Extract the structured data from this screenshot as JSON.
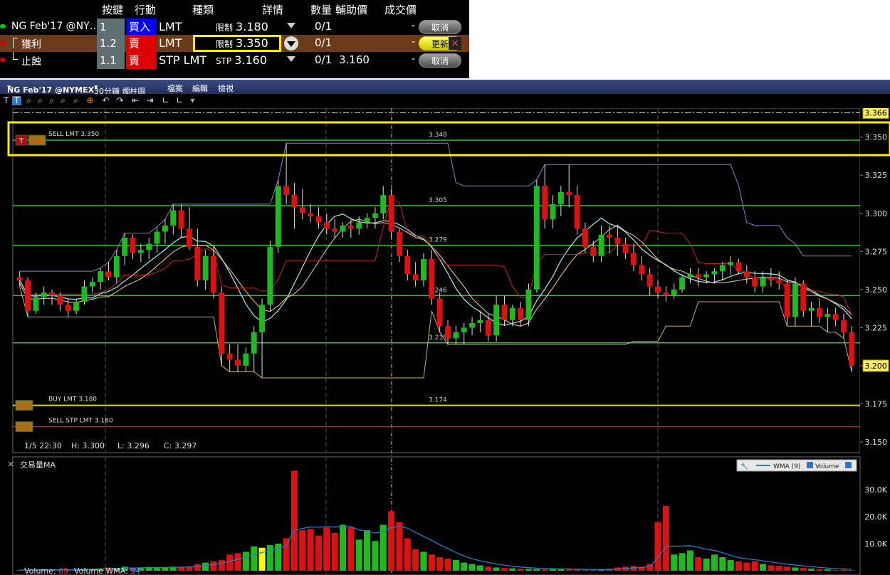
{
  "order_panel": {
    "headers": {
      "key": "按鍵",
      "action": "行動",
      "type": "種類",
      "detail": "詳情",
      "qty": "數量",
      "aux": "輔助價",
      "fill": "成交價"
    },
    "rows": [
      {
        "symbol": "NG Feb'17 @NY…",
        "key": "1",
        "action": "買入",
        "action_color": "#0000ff",
        "type": "LMT",
        "detail_prefix": "限制",
        "detail_price": "3.180",
        "qty": "0/1",
        "aux": "",
        "fill": "-",
        "button": "取消",
        "bullet_color": "#00cc00",
        "row_bg": "#000000"
      },
      {
        "symbol": "獲利",
        "key": "1.2",
        "action": "賣",
        "action_color": "#dd0000",
        "type": "LMT",
        "detail_prefix": "限制",
        "detail_price": "3.350",
        "qty": "0/1",
        "aux": "",
        "fill": "-",
        "button": "更新",
        "close_icon": "×",
        "bullet_color": "#cc0000",
        "row_bg": "#6b3a1a"
      },
      {
        "symbol": "止蝕",
        "key": "1.1",
        "action": "賣",
        "action_color": "#dd0000",
        "type": "STP LMT",
        "detail_prefix": "STP",
        "detail_price": "3.160",
        "qty": "0/1",
        "aux": "3.160",
        "fill": "-",
        "button": "取消",
        "bullet_color": "#cc0000",
        "row_bg": "#000000"
      }
    ]
  },
  "chart": {
    "title_bar": {
      "symbol": "NG Feb'17 @NYMEX",
      "interval": "30分鐘 燭柱圖",
      "menu_file": "檔案",
      "menu_edit": "編輯",
      "menu_view": "檢視"
    },
    "toolbar_icons": [
      "T",
      "T",
      "zoom-in-icon",
      "zoom-out-icon",
      "zoom-out-icon",
      "crosshair-icon",
      "undo-icon",
      "redo-icon",
      "fit-icon",
      "fit-icon",
      "drawing-icon",
      "drawing-icon",
      "chevron-down-icon"
    ],
    "readout": {
      "date": "1/5 22:30",
      "high": "H: 3.300",
      "low": "L: 3.296",
      "close": "C: 3.297"
    },
    "price_axis_ticks": [
      "3.350",
      "3.325",
      "3.300",
      "3.275",
      "3.250",
      "3.225",
      "3.200",
      "3.175",
      "3.150"
    ],
    "price_badges": {
      "top": "3.366",
      "last": "3.200"
    },
    "order_lines": [
      {
        "label": "SELL LMT 3.350",
        "price": 3.348,
        "price_label": "3.348",
        "color": "#22cc22",
        "tags": [
          "T",
          "CXL"
        ]
      },
      {
        "label": "BUY LMT 3.180",
        "price": 3.174,
        "price_label": "3.174",
        "color": "#dddd00",
        "tags": [
          "CXL"
        ]
      },
      {
        "label": "SELL STP LMT 3.160",
        "price": 3.16,
        "price_label": "",
        "color": "#cc2222",
        "tags": [
          "CXL"
        ]
      }
    ],
    "level_lines": [
      {
        "price": 3.305,
        "label": "3.305"
      },
      {
        "price": 3.279,
        "label": "3.279"
      },
      {
        "price": 3.246,
        "label": "3.246"
      },
      {
        "price": 3.215,
        "label": "3.215"
      }
    ],
    "volume_panel": {
      "title": "交易量MA",
      "legend_wma": "WMA (9)",
      "legend_volume": "Volume",
      "axis_ticks": [
        "30.0K",
        "20.0K",
        "10.0K"
      ],
      "volume_label": "Volume:",
      "volume_value": "69",
      "wma_label": "Volume WMA:",
      "wma_value": "94"
    }
  },
  "chart_data": {
    "type": "candlestick",
    "y_range": [
      3.143,
      3.369
    ],
    "candles": [
      [
        3.258,
        3.262,
        3.252,
        3.256
      ],
      [
        3.256,
        3.258,
        3.232,
        3.236
      ],
      [
        3.236,
        3.248,
        3.234,
        3.245
      ],
      [
        3.245,
        3.252,
        3.24,
        3.248
      ],
      [
        3.248,
        3.25,
        3.24,
        3.246
      ],
      [
        3.246,
        3.248,
        3.236,
        3.24
      ],
      [
        3.24,
        3.244,
        3.232,
        3.236
      ],
      [
        3.236,
        3.244,
        3.234,
        3.242
      ],
      [
        3.242,
        3.256,
        3.24,
        3.252
      ],
      [
        3.252,
        3.258,
        3.248,
        3.255
      ],
      [
        3.255,
        3.264,
        3.25,
        3.262
      ],
      [
        3.262,
        3.268,
        3.256,
        3.258
      ],
      [
        3.258,
        3.276,
        3.254,
        3.272
      ],
      [
        3.272,
        3.287,
        3.266,
        3.284
      ],
      [
        3.284,
        3.286,
        3.27,
        3.274
      ],
      [
        3.274,
        3.28,
        3.268,
        3.276
      ],
      [
        3.276,
        3.284,
        3.27,
        3.28
      ],
      [
        3.28,
        3.291,
        3.274,
        3.288
      ],
      [
        3.288,
        3.296,
        3.28,
        3.292
      ],
      [
        3.292,
        3.306,
        3.286,
        3.302
      ],
      [
        3.302,
        3.306,
        3.284,
        3.29
      ],
      [
        3.29,
        3.304,
        3.276,
        3.278
      ],
      [
        3.278,
        3.29,
        3.252,
        3.256
      ],
      [
        3.256,
        3.276,
        3.25,
        3.272
      ],
      [
        3.272,
        3.278,
        3.244,
        3.248
      ],
      [
        3.248,
        3.252,
        3.2,
        3.208
      ],
      [
        3.208,
        3.214,
        3.196,
        3.204
      ],
      [
        3.204,
        3.214,
        3.196,
        3.2
      ],
      [
        3.2,
        3.212,
        3.196,
        3.208
      ],
      [
        3.208,
        3.226,
        3.196,
        3.222
      ],
      [
        3.222,
        3.244,
        3.192,
        3.24
      ],
      [
        3.24,
        3.282,
        3.236,
        3.278
      ],
      [
        3.278,
        3.322,
        3.274,
        3.318
      ],
      [
        3.318,
        3.346,
        3.306,
        3.312
      ],
      [
        3.312,
        3.32,
        3.29,
        3.304
      ],
      [
        3.304,
        3.316,
        3.296,
        3.3
      ],
      [
        3.3,
        3.306,
        3.294,
        3.298
      ],
      [
        3.298,
        3.304,
        3.29,
        3.294
      ],
      [
        3.294,
        3.3,
        3.286,
        3.29
      ],
      [
        3.29,
        3.296,
        3.284,
        3.288
      ],
      [
        3.288,
        3.294,
        3.284,
        3.292
      ],
      [
        3.292,
        3.296,
        3.284,
        3.29
      ],
      [
        3.29,
        3.298,
        3.286,
        3.294
      ],
      [
        3.294,
        3.3,
        3.29,
        3.297
      ],
      [
        3.297,
        3.304,
        3.29,
        3.3
      ],
      [
        3.3,
        3.318,
        3.296,
        3.312
      ],
      [
        3.312,
        3.316,
        3.284,
        3.288
      ],
      [
        3.288,
        3.29,
        3.268,
        3.272
      ],
      [
        3.272,
        3.276,
        3.256,
        3.26
      ],
      [
        3.26,
        3.268,
        3.252,
        3.256
      ],
      [
        3.256,
        3.274,
        3.252,
        3.27
      ],
      [
        3.27,
        3.276,
        3.24,
        3.244
      ],
      [
        3.244,
        3.248,
        3.222,
        3.226
      ],
      [
        3.226,
        3.23,
        3.214,
        3.218
      ],
      [
        3.218,
        3.226,
        3.214,
        3.222
      ],
      [
        3.222,
        3.228,
        3.214,
        3.225
      ],
      [
        3.225,
        3.232,
        3.22,
        3.228
      ],
      [
        3.228,
        3.236,
        3.222,
        3.23
      ],
      [
        3.23,
        3.234,
        3.216,
        3.22
      ],
      [
        3.22,
        3.246,
        3.216,
        3.24
      ],
      [
        3.24,
        3.246,
        3.226,
        3.23
      ],
      [
        3.23,
        3.24,
        3.226,
        3.238
      ],
      [
        3.238,
        3.242,
        3.226,
        3.23
      ],
      [
        3.23,
        3.254,
        3.226,
        3.25
      ],
      [
        3.25,
        3.322,
        3.248,
        3.318
      ],
      [
        3.318,
        3.332,
        3.29,
        3.296
      ],
      [
        3.296,
        3.312,
        3.29,
        3.306
      ],
      [
        3.306,
        3.318,
        3.298,
        3.314
      ],
      [
        3.314,
        3.332,
        3.304,
        3.312
      ],
      [
        3.312,
        3.318,
        3.286,
        3.29
      ],
      [
        3.29,
        3.294,
        3.274,
        3.278
      ],
      [
        3.278,
        3.282,
        3.268,
        3.272
      ],
      [
        3.272,
        3.292,
        3.268,
        3.286
      ],
      [
        3.286,
        3.292,
        3.274,
        3.284
      ],
      [
        3.284,
        3.292,
        3.272,
        3.28
      ],
      [
        3.28,
        3.284,
        3.27,
        3.274
      ],
      [
        3.274,
        3.28,
        3.262,
        3.266
      ],
      [
        3.266,
        3.272,
        3.256,
        3.26
      ],
      [
        3.26,
        3.264,
        3.246,
        3.252
      ],
      [
        3.252,
        3.256,
        3.244,
        3.248
      ],
      [
        3.248,
        3.252,
        3.242,
        3.246
      ],
      [
        3.246,
        3.254,
        3.244,
        3.25
      ],
      [
        3.25,
        3.26,
        3.248,
        3.258
      ],
      [
        3.258,
        3.264,
        3.254,
        3.26
      ],
      [
        3.26,
        3.264,
        3.252,
        3.258
      ],
      [
        3.258,
        3.262,
        3.254,
        3.26
      ],
      [
        3.26,
        3.264,
        3.254,
        3.262
      ],
      [
        3.262,
        3.268,
        3.256,
        3.266
      ],
      [
        3.266,
        3.272,
        3.26,
        3.268
      ],
      [
        3.268,
        3.27,
        3.26,
        3.262
      ],
      [
        3.262,
        3.266,
        3.254,
        3.258
      ],
      [
        3.258,
        3.262,
        3.248,
        3.252
      ],
      [
        3.252,
        3.262,
        3.248,
        3.258
      ],
      [
        3.258,
        3.264,
        3.252,
        3.256
      ],
      [
        3.256,
        3.262,
        3.25,
        3.254
      ],
      [
        3.254,
        3.256,
        3.226,
        3.232
      ],
      [
        3.232,
        3.258,
        3.226,
        3.254
      ],
      [
        3.254,
        3.256,
        3.232,
        3.236
      ],
      [
        3.236,
        3.242,
        3.226,
        3.238
      ],
      [
        3.238,
        3.244,
        3.228,
        3.232
      ],
      [
        3.232,
        3.238,
        3.222,
        3.234
      ],
      [
        3.234,
        3.238,
        3.226,
        3.23
      ],
      [
        3.23,
        3.234,
        3.218,
        3.222
      ],
      [
        3.222,
        3.226,
        3.196,
        3.2
      ]
    ],
    "volume": [
      300,
      250,
      400,
      350,
      300,
      500,
      400,
      600,
      800,
      700,
      900,
      1200,
      900,
      1500,
      1000,
      1200,
      1400,
      1100,
      1300,
      1500,
      1400,
      1600,
      2500,
      3000,
      3500,
      4000,
      6000,
      6500,
      7000,
      9000,
      8500,
      9500,
      10000,
      12000,
      37000,
      15000,
      15500,
      13000,
      16000,
      14000,
      17000,
      16000,
      11500,
      15000,
      11000,
      17000,
      22000,
      18000,
      12000,
      8000,
      7000,
      6000,
      5000,
      4500,
      4000,
      3000,
      2500,
      2000,
      1500,
      1200,
      1000,
      900,
      800,
      700,
      600,
      500,
      800,
      600,
      500,
      400,
      300,
      300,
      400,
      800,
      1200,
      1500,
      1800,
      1500,
      2500,
      18000,
      24000,
      6000,
      6500,
      7500,
      5000,
      4500,
      6000,
      5000,
      4000,
      3500,
      3000,
      3500,
      2500,
      2000,
      1800,
      1500,
      1200,
      1000,
      800,
      600,
      500,
      300,
      400,
      200,
      300
    ],
    "highlight_volume_index": [
      30
    ]
  }
}
